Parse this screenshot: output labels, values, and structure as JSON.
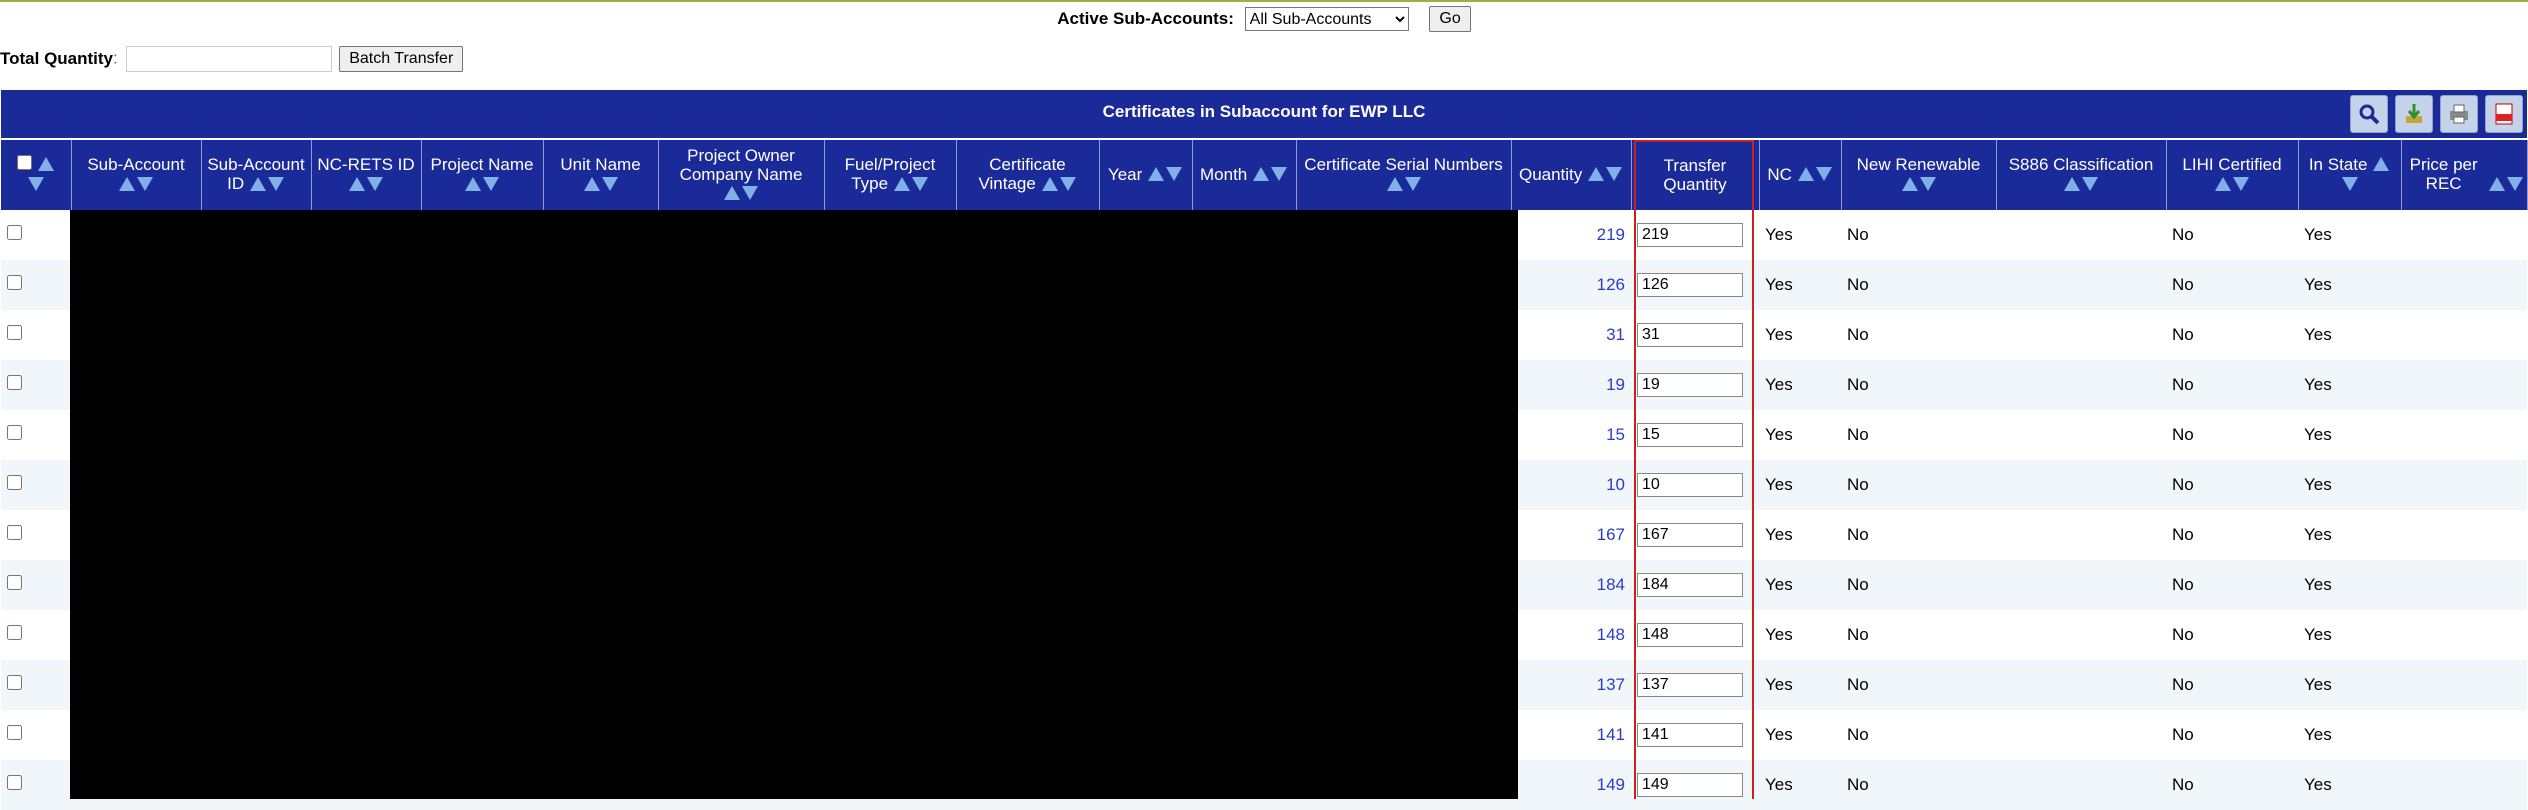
{
  "subaccounts": {
    "label": "Active Sub-Accounts:",
    "selected": "All Sub-Accounts",
    "go_label": "Go"
  },
  "total_quantity": {
    "label": "Total Quantity",
    "colon": ":",
    "value": "",
    "batch_label": "Batch Transfer"
  },
  "grid": {
    "caption": "Certificates in Subaccount for EWP LLC",
    "tools": [
      "search-icon",
      "export-icon",
      "print-icon",
      "pdf-icon"
    ],
    "columns": [
      "",
      "Sub-Account",
      "Sub-Account ID",
      "NC-RETS ID",
      "Project Name",
      "Unit Name",
      "Project Owner Company Name",
      "Fuel/Project Type",
      "Certificate Vintage",
      "Year",
      "Month",
      "Certificate Serial Numbers",
      "Quantity",
      "Transfer Quantity",
      "NC",
      "New Renewable",
      "S886 Classification",
      "LIHI Certified",
      "In State",
      "Price per REC"
    ],
    "rows": [
      {
        "quantity": "219",
        "transfer": "219",
        "nc": "Yes",
        "new_renewable": "No",
        "s886": "",
        "lihi": "No",
        "in_state": "Yes",
        "price": ""
      },
      {
        "quantity": "126",
        "transfer": "126",
        "nc": "Yes",
        "new_renewable": "No",
        "s886": "",
        "lihi": "No",
        "in_state": "Yes",
        "price": ""
      },
      {
        "quantity": "31",
        "transfer": "31",
        "nc": "Yes",
        "new_renewable": "No",
        "s886": "",
        "lihi": "No",
        "in_state": "Yes",
        "price": ""
      },
      {
        "quantity": "19",
        "transfer": "19",
        "nc": "Yes",
        "new_renewable": "No",
        "s886": "",
        "lihi": "No",
        "in_state": "Yes",
        "price": ""
      },
      {
        "quantity": "15",
        "transfer": "15",
        "nc": "Yes",
        "new_renewable": "No",
        "s886": "",
        "lihi": "No",
        "in_state": "Yes",
        "price": ""
      },
      {
        "quantity": "10",
        "transfer": "10",
        "nc": "Yes",
        "new_renewable": "No",
        "s886": "",
        "lihi": "No",
        "in_state": "Yes",
        "price": ""
      },
      {
        "quantity": "167",
        "transfer": "167",
        "nc": "Yes",
        "new_renewable": "No",
        "s886": "",
        "lihi": "No",
        "in_state": "Yes",
        "price": ""
      },
      {
        "quantity": "184",
        "transfer": "184",
        "nc": "Yes",
        "new_renewable": "No",
        "s886": "",
        "lihi": "No",
        "in_state": "Yes",
        "price": ""
      },
      {
        "quantity": "148",
        "transfer": "148",
        "nc": "Yes",
        "new_renewable": "No",
        "s886": "",
        "lihi": "No",
        "in_state": "Yes",
        "price": ""
      },
      {
        "quantity": "137",
        "transfer": "137",
        "nc": "Yes",
        "new_renewable": "No",
        "s886": "",
        "lihi": "No",
        "in_state": "Yes",
        "price": ""
      },
      {
        "quantity": "141",
        "transfer": "141",
        "nc": "Yes",
        "new_renewable": "No",
        "s886": "",
        "lihi": "No",
        "in_state": "Yes",
        "price": ""
      },
      {
        "quantity": "149",
        "transfer": "149",
        "nc": "Yes",
        "new_renewable": "No",
        "s886": "",
        "lihi": "No",
        "in_state": "Yes",
        "price": ""
      }
    ]
  },
  "colors": {
    "header_bg": "#1b2a99",
    "sort_arrow": "#7fb0e8",
    "link": "#2a3cc8",
    "highlight": "#cc1f1f",
    "alt_row": "#f1f6fb"
  }
}
